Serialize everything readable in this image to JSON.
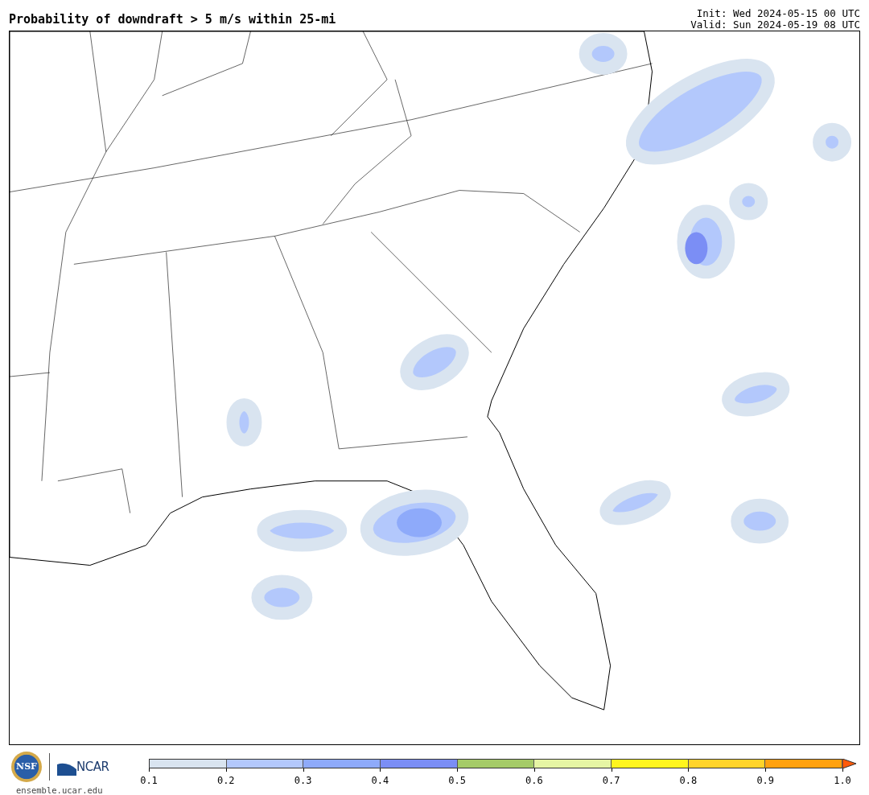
{
  "header": {
    "title": "Probability of downdraft > 5 m/s within 25-mi",
    "init": "Init: Wed 2024-05-15 00 UTC",
    "valid": "Valid: Sun 2024-05-19 08 UTC"
  },
  "footer": {
    "nsf_logo": "NSF",
    "ncar_logo": "NCAR",
    "site": "ensemble.ucar.edu"
  },
  "colorbar": {
    "bins": [
      {
        "color": "#d9e4f0"
      },
      {
        "color": "#b3c8fc"
      },
      {
        "color": "#8eaafa"
      },
      {
        "color": "#7b8ef5"
      },
      {
        "color": "#a5cb68"
      },
      {
        "color": "#e6f5a4"
      },
      {
        "color": "#fff51e"
      },
      {
        "color": "#ffd42a"
      },
      {
        "color": "#ffa10f"
      }
    ],
    "extension": {
      "color": "#ff5a0a"
    },
    "ticks": [
      "0.1",
      "0.2",
      "0.3",
      "0.4",
      "0.5",
      "0.6",
      "0.7",
      "0.8",
      "0.9",
      "1.0"
    ]
  }
}
